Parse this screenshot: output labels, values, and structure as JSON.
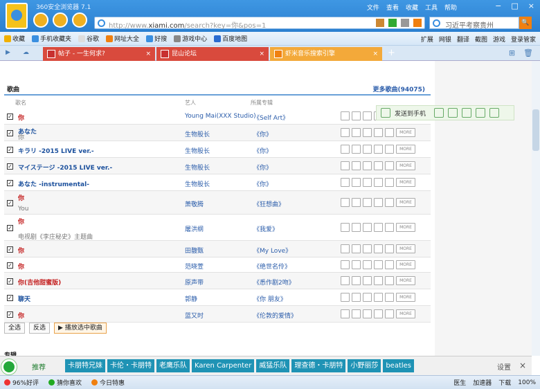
{
  "window": {
    "app_name": "360安全浏览器 7.1",
    "menus": [
      "文件",
      "查看",
      "收藏",
      "工具",
      "帮助"
    ],
    "controls": [
      "−",
      "□",
      "×"
    ]
  },
  "address": {
    "url_prefix": "http://www.",
    "url_domain": "xiami.com",
    "url_rest": "/search?key=你&pos=1"
  },
  "search": {
    "value": "习近平考察贵州"
  },
  "favorites": {
    "items": [
      "收藏",
      "手机收藏夹",
      "谷歌",
      "网址大全",
      "好搜",
      "游戏中心",
      "百度地图"
    ],
    "right_items": [
      "扩展",
      "网银",
      "翻译",
      "截图",
      "游戏",
      "登录管家"
    ]
  },
  "tabs": [
    {
      "title": "帖子 - 一生何求?"
    },
    {
      "title": "昆山论坛"
    },
    {
      "title": "虾米音乐搜索引擎"
    }
  ],
  "section": {
    "heading": "歌曲",
    "more": "更多歌曲(94075)"
  },
  "columns": {
    "song": "歌名",
    "artist": "艺人",
    "album": "所属专辑"
  },
  "send_bar": {
    "label": "发送到手机"
  },
  "more_label": "MORE",
  "rows": [
    {
      "song": "你",
      "sub": "",
      "artist": "Young Mai(XXX Studio)",
      "album": "《Self Art》"
    },
    {
      "song": "あなた",
      "sub": "你",
      "artist": "生物股长",
      "album": "《你》"
    },
    {
      "song": "キラリ -2015 LIVE ver.-",
      "sub": "",
      "artist": "生物股长",
      "album": "《你》"
    },
    {
      "song": "マイステージ -2015 LIVE ver.-",
      "sub": "",
      "artist": "生物股长",
      "album": "《你》"
    },
    {
      "song": "あなた -instrumental-",
      "sub": "",
      "artist": "生物股长",
      "album": "《你》"
    },
    {
      "song": "你",
      "sub": "You",
      "artist": "萧敬腾",
      "album": "《狂想曲》"
    },
    {
      "song": "你",
      "sub": "电视剧《李庄秘史》主题曲",
      "artist": "屠洪纲",
      "album": "《我爱》"
    },
    {
      "song": "你",
      "sub": "",
      "artist": "田馥甄",
      "album": "《My Love》"
    },
    {
      "song": "你",
      "sub": "",
      "artist": "范晓萱",
      "album": "《绝世名伶》"
    },
    {
      "song": "你(吉他甜蜜版)",
      "sub": "",
      "artist": "原声带",
      "album": "《悉作剧2吻》"
    },
    {
      "song": "聊天",
      "sub": "",
      "artist": "郭静",
      "album": "《你 朋友》"
    },
    {
      "song": "你",
      "sub": "",
      "artist": "蓝又时",
      "album": "《伦敦的爱情》"
    }
  ],
  "buttons": {
    "select_all": "全选",
    "invert": "反选",
    "play_selected": "播放选中歌曲"
  },
  "next_section": "专辑",
  "bottom": {
    "recommend": "推荐",
    "chips": [
      "卡朋特兄妹",
      "卡伦・卡朋特",
      "老鹰乐队",
      "Karen Carpenter",
      "威猛乐队",
      "理查德・卡朋特",
      "小野丽莎",
      "beatles"
    ],
    "settings": "设置"
  },
  "status": {
    "left": [
      "96%好评",
      "猜你喜欢",
      "今日特惠"
    ],
    "right": [
      "医生",
      "加速器",
      "下载"
    ],
    "zoom": "100%"
  }
}
